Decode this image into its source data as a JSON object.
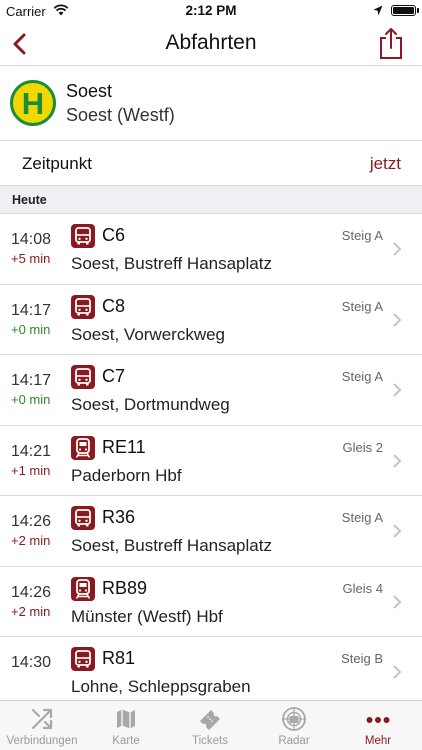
{
  "status_bar": {
    "carrier": "Carrier",
    "time": "2:12 PM"
  },
  "nav": {
    "title": "Abfahrten"
  },
  "stop": {
    "name": "Soest",
    "subtitle": "Soest (Westf)",
    "logo_letter": "H"
  },
  "time_selector": {
    "label": "Zeitpunkt",
    "value": "jetzt"
  },
  "section": {
    "title": "Heute"
  },
  "colors": {
    "accent": "#8a1a1f",
    "on_time": "#2a8a2a",
    "stop_logo_yellow": "#f2d800",
    "stop_logo_green": "#1a8c3c"
  },
  "departures": [
    {
      "time": "14:08",
      "delay": "+5 min",
      "status": "late",
      "mode": "bus-icon",
      "line": "C6",
      "track": "Steig A",
      "destination": "Soest, Bustreff Hansaplatz"
    },
    {
      "time": "14:17",
      "delay": "+0 min",
      "status": "ontime",
      "mode": "bus-icon",
      "line": "C8",
      "track": "Steig A",
      "destination": "Soest, Vorwerckweg"
    },
    {
      "time": "14:17",
      "delay": "+0 min",
      "status": "ontime",
      "mode": "bus-icon",
      "line": "C7",
      "track": "Steig A",
      "destination": "Soest, Dortmundweg"
    },
    {
      "time": "14:21",
      "delay": "+1 min",
      "status": "late",
      "mode": "train-icon",
      "line": "RE11",
      "track": "Gleis 2",
      "destination": "Paderborn Hbf"
    },
    {
      "time": "14:26",
      "delay": "+2 min",
      "status": "late",
      "mode": "bus-icon",
      "line": "R36",
      "track": "Steig A",
      "destination": "Soest, Bustreff Hansaplatz"
    },
    {
      "time": "14:26",
      "delay": "+2 min",
      "status": "late",
      "mode": "train-icon",
      "line": "RB89",
      "track": "Gleis 4",
      "destination": "Münster (Westf) Hbf"
    },
    {
      "time": "14:30",
      "delay": "",
      "status": "ontime",
      "mode": "bus-icon",
      "line": "R81",
      "track": "Steig B",
      "destination": "Lohne, Schleppsgraben"
    }
  ],
  "tabs": [
    {
      "label": "Verbindungen",
      "icon": "connections-icon",
      "active": false
    },
    {
      "label": "Karte",
      "icon": "map-icon",
      "active": false
    },
    {
      "label": "Tickets",
      "icon": "ticket-icon",
      "active": false
    },
    {
      "label": "Radar",
      "icon": "radar-icon",
      "active": false
    },
    {
      "label": "Mehr",
      "icon": "more-icon",
      "active": true
    }
  ]
}
